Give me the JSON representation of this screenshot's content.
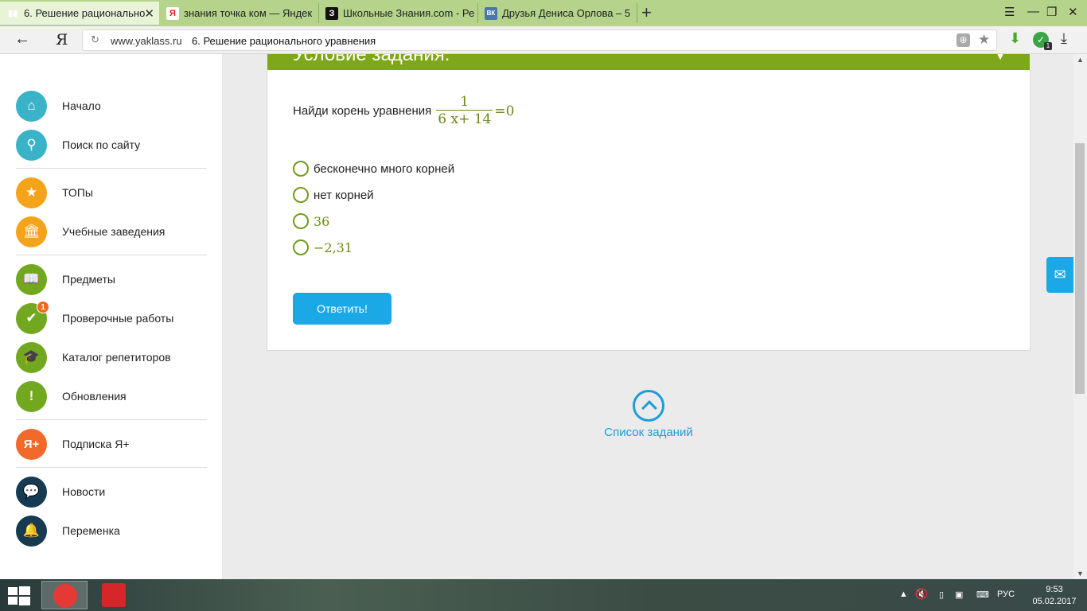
{
  "browser": {
    "tabs": [
      {
        "label": "6. Решение рационально",
        "favicon": "book-icon",
        "active": true
      },
      {
        "label": "знания точка ком — Яндек",
        "favicon": "yandex-icon"
      },
      {
        "label": "Школьные Знания.com - Ре",
        "favicon": "znanija-icon"
      },
      {
        "label": "Друзья Дениса Орлова – 5",
        "favicon": "vk-icon"
      }
    ],
    "favicon_texts": [
      "Я",
      "З",
      "ВК"
    ],
    "address": {
      "domain": "www.yaklass.ru",
      "title": "6. Решение рационального уравнения",
      "yandex_logo": "Я"
    }
  },
  "sidebar": {
    "items": [
      {
        "label": "Начало",
        "icon": "home-icon",
        "color": "#3ab3c9"
      },
      {
        "label": "Поиск по сайту",
        "icon": "search-icon",
        "color": "#3ab3c9"
      },
      {
        "label": "ТОПы",
        "icon": "star-icon",
        "color": "#f5a31a"
      },
      {
        "label": "Учебные заведения",
        "icon": "building-icon",
        "color": "#f5a31a"
      },
      {
        "label": "Предметы",
        "icon": "book-open-icon",
        "color": "#72a81f"
      },
      {
        "label": "Проверочные работы",
        "icon": "checkmark-icon",
        "color": "#72a81f",
        "badge": "1"
      },
      {
        "label": "Каталог репетиторов",
        "icon": "graduation-cap-icon",
        "color": "#72a81f"
      },
      {
        "label": "Обновления",
        "icon": "exclamation-icon",
        "color": "#72a81f"
      },
      {
        "label": "Подписка Я+",
        "icon": "ya-plus-icon",
        "color": "#f26a2b",
        "icon_text": "Я+"
      },
      {
        "label": "Новости",
        "icon": "chat-icon",
        "color": "#153a52"
      },
      {
        "label": "Переменка",
        "icon": "bell-icon",
        "color": "#153a52"
      }
    ]
  },
  "task": {
    "header": "Условие задания:",
    "question_text": "Найди корень уравнения",
    "fraction": {
      "numerator": "1",
      "denominator": "6 x+ 14",
      "rhs": "=0"
    },
    "options": [
      {
        "label": "бесконечно много корней",
        "math": false
      },
      {
        "label": "нет корней",
        "math": false
      },
      {
        "label": "36",
        "math": true
      },
      {
        "label": "−2,31",
        "math": true
      }
    ],
    "submit_label": "Ответить!"
  },
  "task_list_link": "Список заданий",
  "taskbar": {
    "language": "РУС",
    "time": "9:53",
    "date": "05.02.2017"
  }
}
